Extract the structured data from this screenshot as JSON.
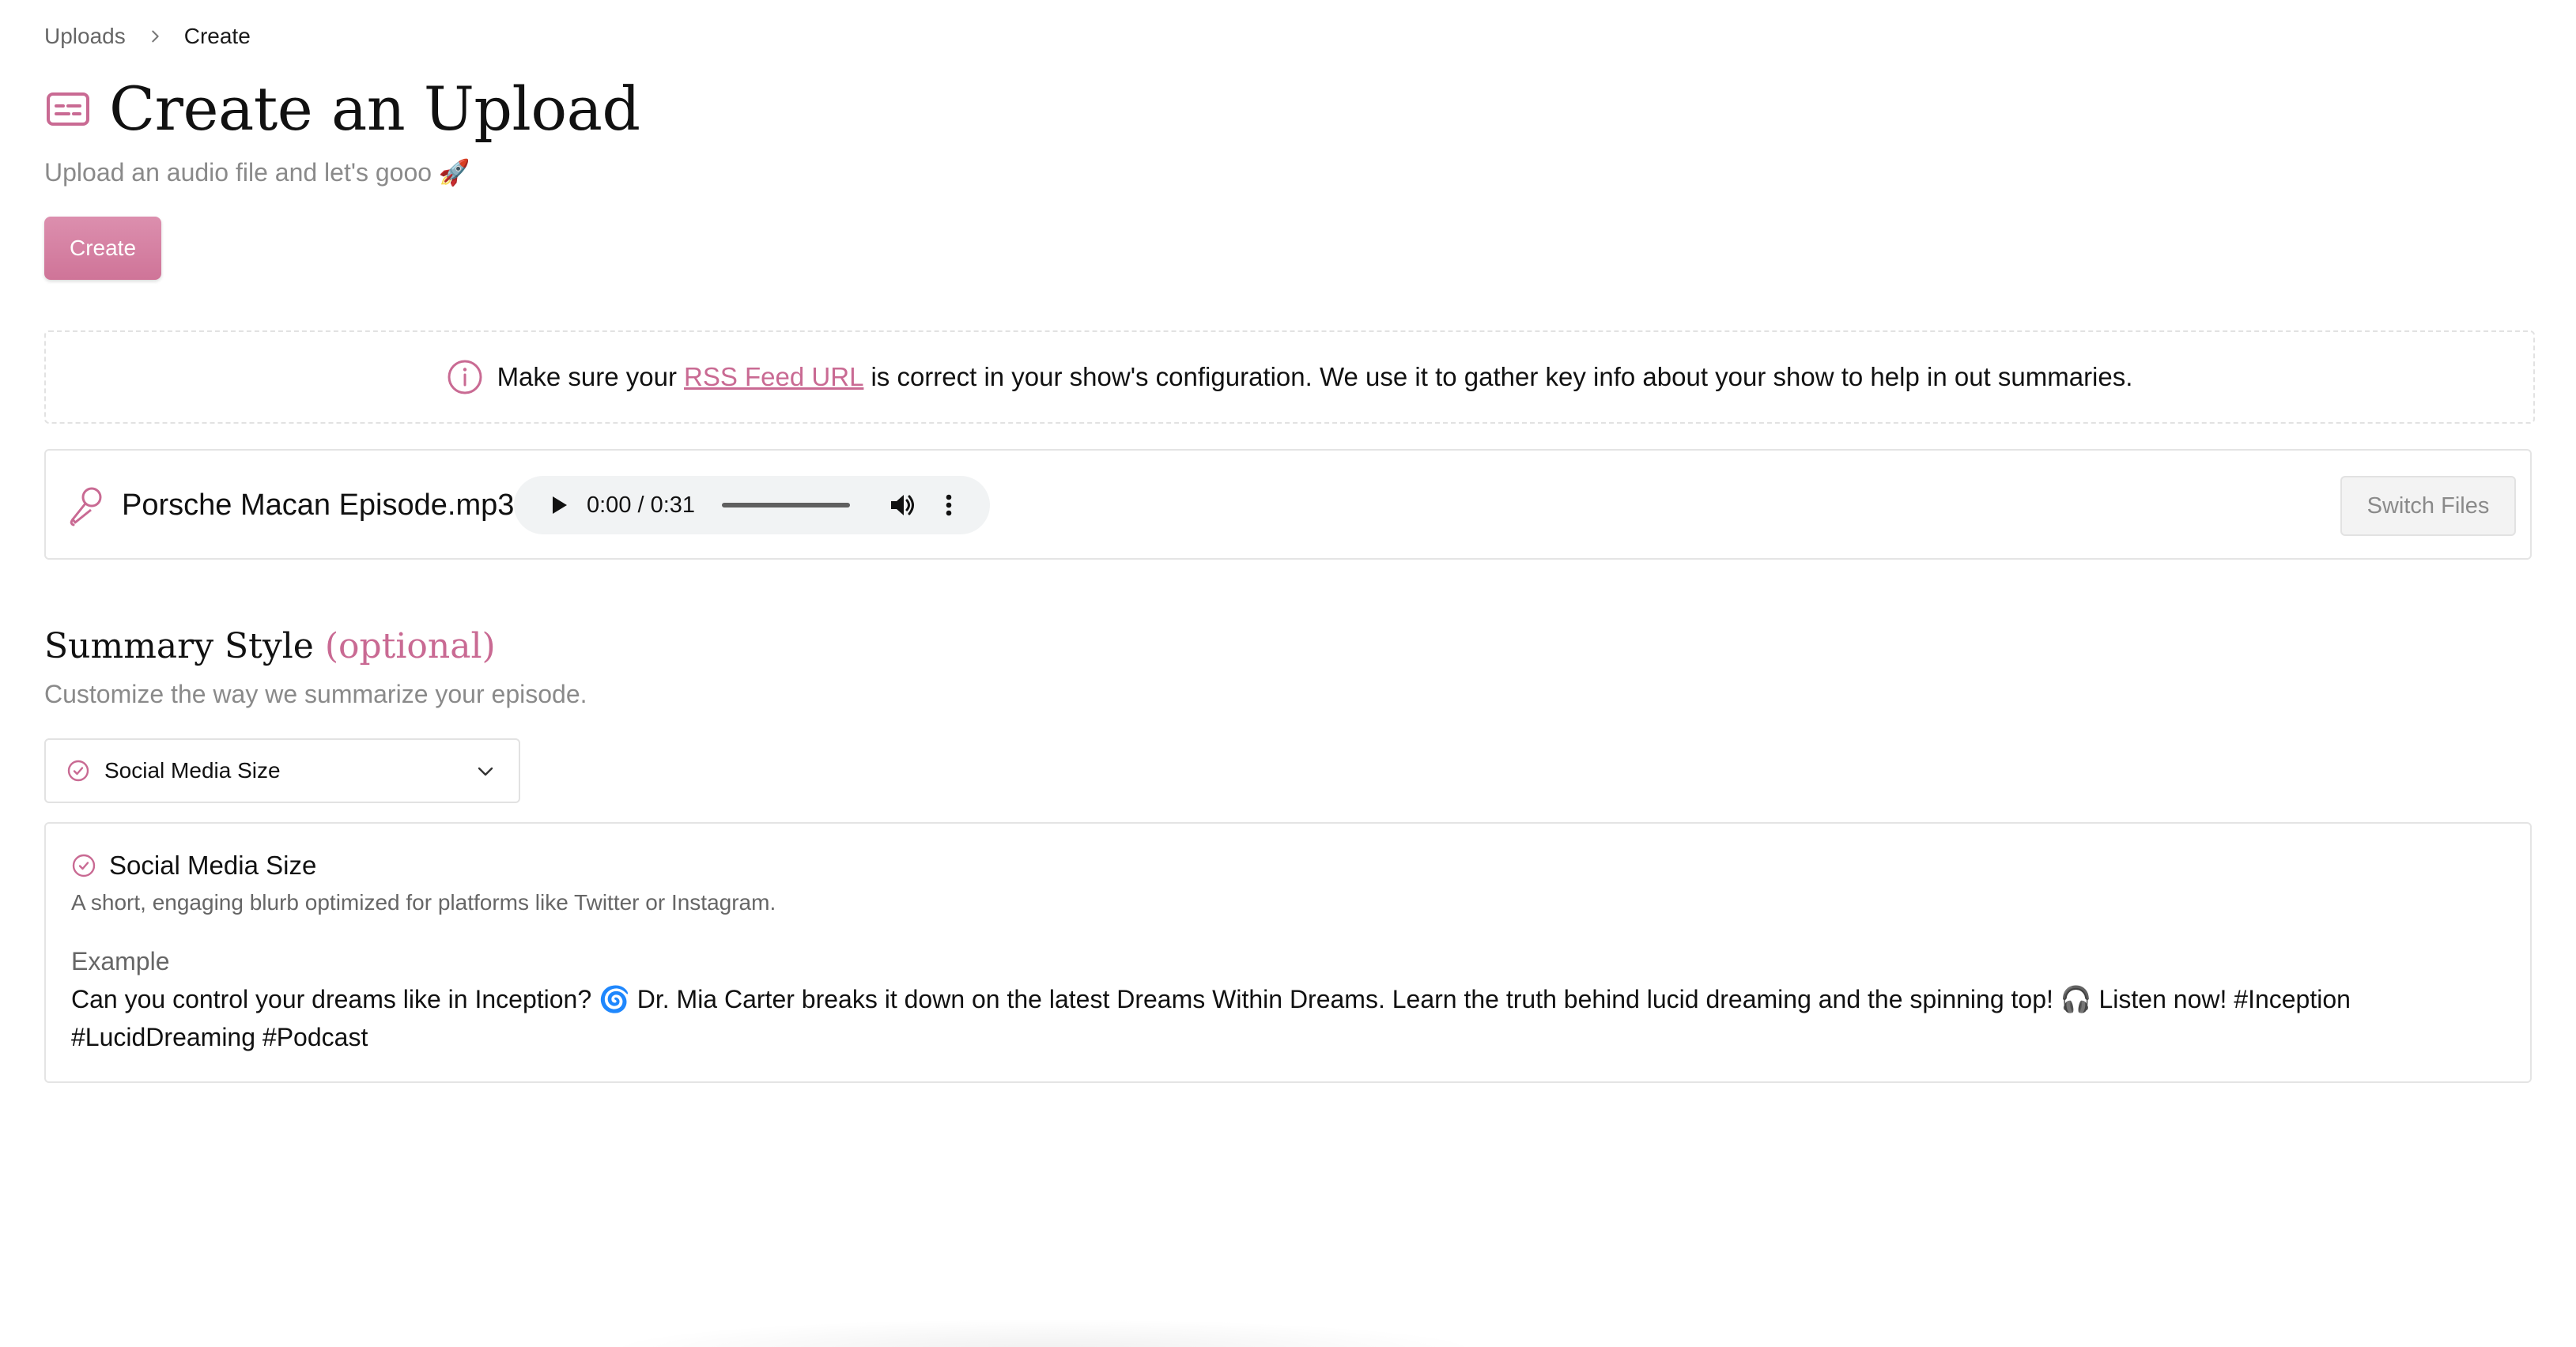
{
  "breadcrumb": {
    "parent": "Uploads",
    "current": "Create"
  },
  "header": {
    "title": "Create an Upload",
    "subtitle": "Upload an audio file and let's gooo 🚀",
    "create_label": "Create"
  },
  "notice": {
    "before": "Make sure your",
    "link": "RSS Feed URL",
    "after": "is correct in your show's configuration. We use it to gather key info about your show to help in out summaries."
  },
  "file": {
    "name": "Porsche Macan Episode.mp3",
    "time": "0:00 / 0:31",
    "progress": 0,
    "switch_label": "Switch Files"
  },
  "summary": {
    "title": "Summary Style",
    "optional": "(optional)",
    "description": "Customize the way we summarize your episode.",
    "selected": "Social Media Size",
    "detail_title": "Social Media Size",
    "detail_desc": "A short, engaging blurb optimized for platforms like Twitter or Instagram.",
    "example_label": "Example",
    "example_text": "Can you control your dreams like in Inception? 🌀 Dr. Mia Carter breaks it down on the latest Dreams Within Dreams. Learn the truth behind lucid dreaming and the spinning top! 🎧 Listen now! #Inception #LucidDreaming #Podcast"
  },
  "colors": {
    "accent": "#c96a93",
    "button": "#d886a8",
    "muted_text": "#8a8a8a"
  },
  "icons": {
    "title": "caption-card-icon",
    "notice": "info-circle-icon",
    "file": "microphone-icon",
    "check": "check-circle-icon",
    "dropdown": "chevron-down-icon"
  }
}
